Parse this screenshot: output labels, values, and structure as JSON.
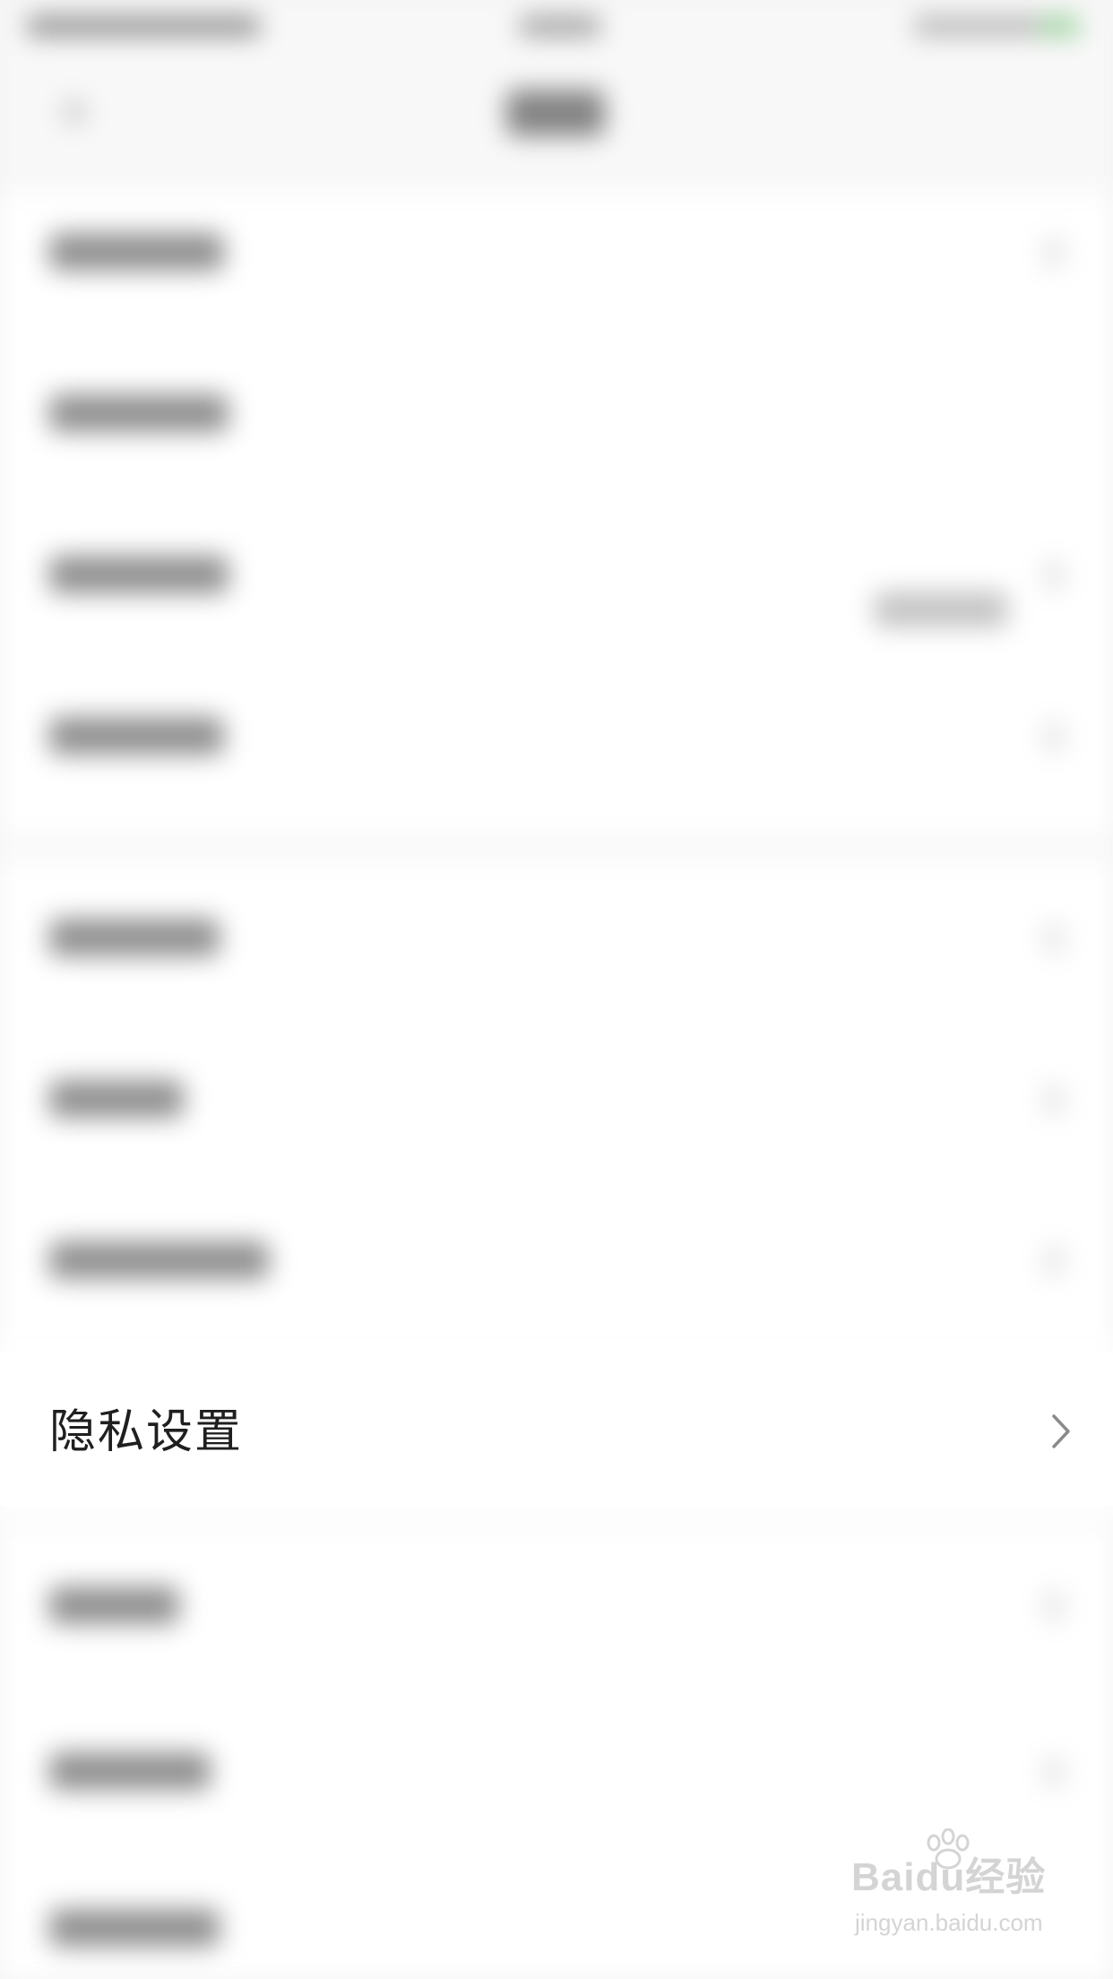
{
  "privacy_settings": {
    "label": "隐私设置",
    "chevron": "chevron-right-icon"
  },
  "watermark": {
    "logo": "Baidu经验",
    "url": "jingyan.baidu.com"
  },
  "colors": {
    "label_text": "#1f1f1f",
    "chevron": "#8a8a8a",
    "background": "#f4f4f4",
    "row_background": "#ffffff",
    "battery": "#4caf50"
  }
}
